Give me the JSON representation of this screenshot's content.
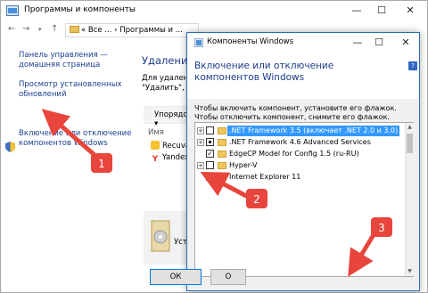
{
  "background_window": {
    "title": "Программы и компоненты",
    "breadcrumb": "«  Все ...  ›  Программы и ...",
    "sidebar": {
      "links": [
        "Панель управления — домашняя страница",
        "Просмотр установленных обновлений",
        "Включение или отключение компонентов Windows"
      ]
    },
    "content": {
      "title": "Удаление",
      "description_lines": [
        "Для удалени",
        "\"Удалить\", \"И"
      ],
      "toolbar_label": "Упорядочить ▾",
      "column_name": "Имя",
      "programs": [
        "Recuva",
        "Yandex"
      ],
      "bottom_text": "Уста"
    }
  },
  "dialog": {
    "title": "Компоненты Windows",
    "heading": "Включение или отключение компонентов Windows",
    "help_label": "?",
    "description": "Чтобы включить компонент, установите его флажок. Чтобы отключить компонент, снимите его флажок. Затененный флажок означает, что компонент включен частично.",
    "features": [
      {
        "label": ".NET Framework 3.5 (включает .NET 2.0 и 3.0)",
        "state": "unchecked",
        "expandable": true,
        "selected": true
      },
      {
        "label": ".NET Framework 4.6 Advanced Services",
        "state": "partial",
        "expandable": true,
        "selected": false
      },
      {
        "label": "EdgeCP Model for Config 1.5 (ru-RU)",
        "state": "checked",
        "expandable": false,
        "selected": false
      },
      {
        "label": "Hyper-V",
        "state": "unchecked",
        "expandable": true,
        "selected": false
      },
      {
        "label": "Internet Explorer 11",
        "state": "checked",
        "expandable": false,
        "selected": false
      }
    ],
    "ok_label": "ОК",
    "cancel_label": "О"
  },
  "annotations": {
    "badges": [
      "1",
      "2",
      "3"
    ],
    "color": "#e8453c"
  }
}
